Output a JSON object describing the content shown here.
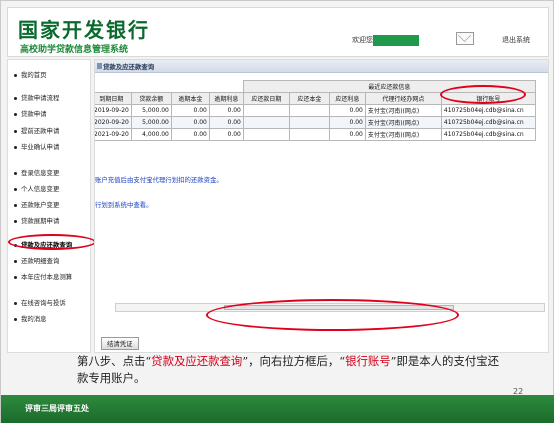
{
  "header": {
    "bank_title": "国家开发银行",
    "system_title": "高校助学贷款信息管理系统",
    "welcome_text": "欢迎您",
    "logout_label": "退出系统"
  },
  "sidebar": {
    "items": [
      {
        "label": "我的首页"
      },
      {
        "label": "贷款申请流程"
      },
      {
        "label": "贷款申请"
      },
      {
        "label": "提前还款申请"
      },
      {
        "label": "毕业确认申请"
      },
      {
        "label": "登录信息变更"
      },
      {
        "label": "个人信息变更"
      },
      {
        "label": "还款账户变更"
      },
      {
        "label": "贷款展期申请"
      },
      {
        "label": "贷款及应还款查询"
      },
      {
        "label": "还款明细查询"
      },
      {
        "label": "本年应付本息测算"
      },
      {
        "label": "在线咨询与投诉"
      },
      {
        "label": "我的消息"
      }
    ]
  },
  "panel": {
    "title": "贷款及应还款查询"
  },
  "table": {
    "group_header": "最近应还款信息",
    "columns": [
      "到期日期",
      "贷款余额",
      "逾期本金",
      "逾期利息",
      "应还款日期",
      "应还本金",
      "应还利息",
      "代理行经办网点",
      "银行账号"
    ],
    "rows": [
      [
        "2019-09-20",
        "5,000.00",
        "0.00",
        "0.00",
        "",
        "",
        "0.00",
        "支付宝(河南)(网点)",
        "410725b04ej.cdb@sina.cn"
      ],
      [
        "2020-09-20",
        "5,000.00",
        "0.00",
        "0.00",
        "",
        "",
        "0.00",
        "支付宝(河南)(网点)",
        "410725b04ej.cdb@sina.cn"
      ],
      [
        "2021-09-20",
        "4,000.00",
        "0.00",
        "0.00",
        "",
        "",
        "0.00",
        "支付宝(河南)(网点)",
        "410725b04ej.cdb@sina.cn"
      ]
    ]
  },
  "notes": {
    "line1": "账户充值后由支付宝代理行划扣的还款资金。",
    "line2": "行划到系统中查看。"
  },
  "buttons": {
    "proof_label": "结清凭证"
  },
  "caption": {
    "part1": "第八步、点击“",
    "highlight1": "贷款及应还款查询",
    "part2": "”，向右拉方框后，“",
    "highlight2": "银行账号",
    "part3": "”即是本人的支付宝还款专用账户。"
  },
  "page_number": "22",
  "footer": {
    "text": "评审三局评审五处"
  }
}
